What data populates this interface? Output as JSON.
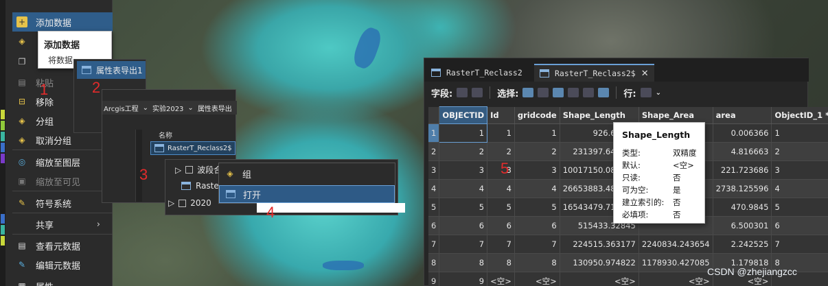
{
  "context_menu": {
    "items": [
      {
        "label": "添加数据",
        "icon": "add-data-icon",
        "highlight": true
      },
      {
        "label": "",
        "icon": "layers-icon"
      },
      {
        "label": "",
        "icon": "copy-icon"
      },
      {
        "label": "粘贴",
        "icon": "paste-icon",
        "disabled": true
      },
      {
        "label": "移除",
        "icon": "remove-icon"
      },
      {
        "label": "分组",
        "icon": "group-icon"
      },
      {
        "label": "取消分组",
        "icon": "ungroup-icon"
      },
      {
        "label": "缩放至图层",
        "icon": "zoom-layer-icon"
      },
      {
        "label": "缩放至可见",
        "icon": "zoom-visible-icon",
        "disabled": true
      },
      {
        "label": "符号系统",
        "icon": "symbology-icon"
      },
      {
        "label": "共享",
        "icon": "share-icon"
      },
      {
        "label": "查看元数据",
        "icon": "view-metadata-icon"
      },
      {
        "label": "编辑元数据",
        "icon": "edit-metadata-icon"
      },
      {
        "label": "属性",
        "icon": "properties-icon"
      }
    ],
    "share_chevron": "›"
  },
  "add_data_tip": {
    "title": "添加数据",
    "text": "将数据"
  },
  "export_submenu": {
    "label": "属性表导出1"
  },
  "catalog": {
    "breadcrumb": [
      "Arcgis工程",
      "实验2023",
      "属性表导出"
    ],
    "column_name": "名称",
    "selected_item": "RasterT_Reclass2$"
  },
  "toc": {
    "layer_band": "波段合",
    "layer_raster": "Raste",
    "layer_year": "2020"
  },
  "layer_menu": {
    "group_label": "组",
    "open_label": "打开"
  },
  "annotations": [
    "1",
    "2",
    "3",
    "4",
    "5"
  ],
  "attribute_table": {
    "tabs": [
      {
        "label": "RasterT_Reclass2",
        "active": false
      },
      {
        "label": "RasterT_Reclass2$",
        "active": true
      }
    ],
    "close_glyph": "✕",
    "toolbar": {
      "fields_label": "字段:",
      "selection_label": "选择:",
      "rows_label": "行:"
    },
    "columns": [
      "OBJECTID",
      "Id",
      "gridcode",
      "Shape_Length",
      "Shape_Area",
      "area",
      "ObjectID_1 *"
    ],
    "rows": [
      [
        "1",
        "1",
        "1",
        "1",
        "926.69634",
        "",
        "0.006366",
        "1"
      ],
      [
        "2",
        "2",
        "2",
        "2",
        "231397.641926",
        "",
        "4.816663",
        "2"
      ],
      [
        "3",
        "3",
        "3",
        "3",
        "10017150.086147",
        "",
        "221.723686",
        "3"
      ],
      [
        "4",
        "4",
        "4",
        "4",
        "26653883.486967",
        "",
        "2738.125596",
        "4"
      ],
      [
        "5",
        "5",
        "5",
        "5",
        "16543479.718177",
        "",
        "470.9845",
        "5"
      ],
      [
        "6",
        "6",
        "6",
        "6",
        "515433.32845",
        "",
        "6.500301",
        "6"
      ],
      [
        "7",
        "7",
        "7",
        "7",
        "224515.363177",
        "2240834.243654",
        "2.242525",
        "7"
      ],
      [
        "8",
        "8",
        "8",
        "8",
        "130950.974822",
        "1178930.427085",
        "1.179818",
        "8"
      ],
      [
        "9",
        "9",
        "<空>",
        "<空>",
        "<空>",
        "<空>",
        "<空>",
        ""
      ]
    ]
  },
  "field_tooltip": {
    "title": "Shape_Length",
    "props": [
      {
        "k": "类型:",
        "v": "双精度"
      },
      {
        "k": "默认:",
        "v": "<空>"
      },
      {
        "k": "只读:",
        "v": "否"
      },
      {
        "k": "可为空:",
        "v": "是"
      },
      {
        "k": "建立索引的:",
        "v": "否"
      },
      {
        "k": "必填项:",
        "v": "否"
      }
    ]
  },
  "watermark": "CSDN @zhejiangzcc"
}
